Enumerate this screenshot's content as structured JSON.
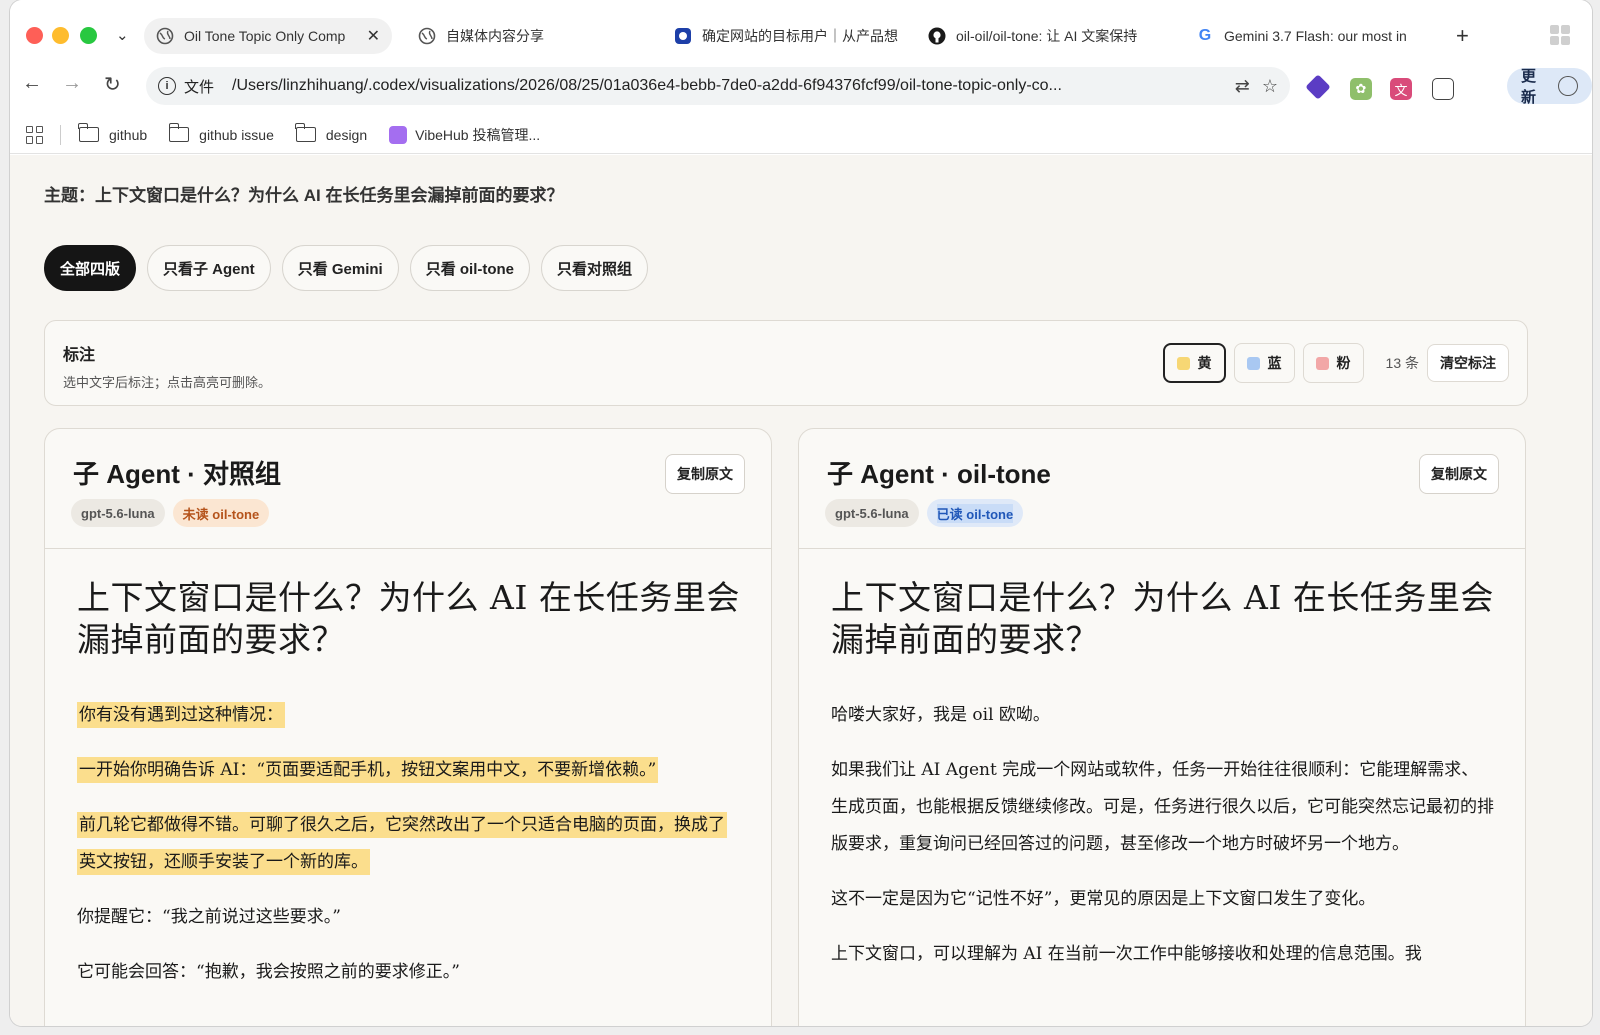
{
  "browser": {
    "tabs": [
      {
        "title": "Oil Tone Topic Only Comp",
        "active": true,
        "icon": "globe-icon"
      },
      {
        "title": "自媒体内容分享",
        "active": false,
        "icon": "globe-icon"
      },
      {
        "title": "确定网站的目标用户｜从产品想",
        "active": false,
        "icon": "app-icon"
      },
      {
        "title": "oil-oil/oil-tone: 让 AI 文案保持",
        "active": false,
        "icon": "github-icon"
      },
      {
        "title": "Gemini 3.7 Flash: our most in",
        "active": false,
        "icon": "google-icon"
      }
    ],
    "omnibox": {
      "scheme_label": "文件",
      "url": "/Users/linzhihuang/.codex/visualizations/2026/08/25/01a036e4-bebb-7de0-a2dd-6f94376fcf99/oil-tone-topic-only-co..."
    },
    "update_label": "更新",
    "bookmarks": [
      "github",
      "github issue",
      "design",
      "VibeHub 投稿管理..."
    ]
  },
  "page": {
    "topic": "主题：上下文窗口是什么？为什么 AI 在长任务里会漏掉前面的要求？",
    "filters": [
      {
        "label": "全部四版",
        "active": true
      },
      {
        "label": "只看子 Agent",
        "active": false
      },
      {
        "label": "只看 Gemini",
        "active": false
      },
      {
        "label": "只看 oil-tone",
        "active": false
      },
      {
        "label": "只看对照组",
        "active": false
      }
    ],
    "annotations": {
      "title": "标注",
      "hint": "选中文字后标注；点击高亮可删除。",
      "colors": [
        {
          "label": "黄",
          "swatch": "#f7d774",
          "active": true
        },
        {
          "label": "蓝",
          "swatch": "#a9c8f2",
          "active": false
        },
        {
          "label": "粉",
          "swatch": "#f2a7a7",
          "active": false
        }
      ],
      "count": "13 条",
      "clear_label": "清空标注"
    },
    "panels": [
      {
        "title": "子 Agent · 对照组",
        "copy_label": "复制原文",
        "model_tag": "gpt-5.6-luna",
        "status_tag": "未读 oil-tone",
        "doc_title": "上下文窗口是什么？为什么 AI 在长任务里会漏掉前面的要求？",
        "paragraphs": [
          {
            "text": "你有没有遇到过这种情况：",
            "highlighted": true
          },
          {
            "text": "一开始你明确告诉 AI：“页面要适配手机，按钮文案用中文，不要新增依赖。”",
            "highlighted": true
          },
          {
            "text": "前几轮它都做得不错。可聊了很久之后，它突然改出了一个只适合电脑的页面，换成了英文按钮，还顺手安装了一个新的库。",
            "highlighted": true
          },
          {
            "text": "你提醒它：“我之前说过这些要求。”",
            "highlighted": false
          },
          {
            "text": "它可能会回答：“抱歉，我会按照之前的要求修正。”",
            "highlighted": false
          }
        ]
      },
      {
        "title": "子 Agent · oil-tone",
        "copy_label": "复制原文",
        "model_tag": "gpt-5.6-luna",
        "status_tag": "已读 oil-tone",
        "doc_title": "上下文窗口是什么？为什么 AI 在长任务里会漏掉前面的要求？",
        "paragraphs": [
          {
            "text": "哈喽大家好，我是 oil 欧呦。",
            "highlighted": false
          },
          {
            "text": "如果我们让 AI Agent 完成一个网站或软件，任务一开始往往很顺利：它能理解需求、生成页面，也能根据反馈继续修改。可是，任务进行很久以后，它可能突然忘记最初的排版要求，重复询问已经回答过的问题，甚至修改一个地方时破坏另一个地方。",
            "highlighted": false
          },
          {
            "text": "这不一定是因为它“记性不好”，更常见的原因是上下文窗口发生了变化。",
            "highlighted": false
          },
          {
            "text": "上下文窗口，可以理解为 AI 在当前一次工作中能够接收和处理的信息范围。我",
            "highlighted": false
          }
        ]
      }
    ]
  }
}
